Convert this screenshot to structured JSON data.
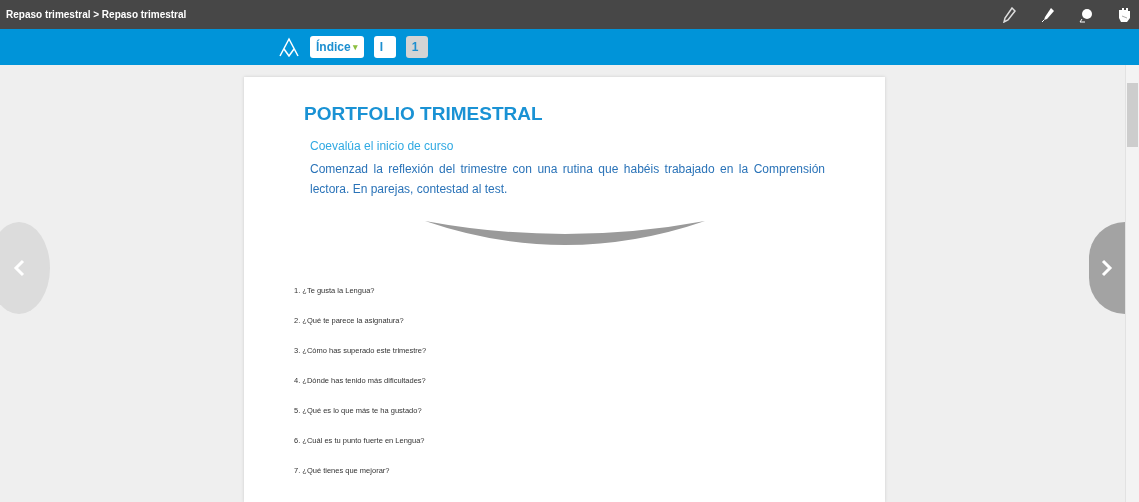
{
  "breadcrumb": "Repaso trimestral > Repaso trimestral",
  "tools": [
    {
      "kind": "pencil"
    },
    {
      "kind": "marker"
    },
    {
      "kind": "eraser"
    },
    {
      "kind": "hand"
    }
  ],
  "nav": {
    "index_label": "Índice",
    "index_caret": "▾",
    "pages": [
      {
        "label": "I",
        "selected": false
      },
      {
        "label": "1",
        "selected": true
      }
    ]
  },
  "document": {
    "title": "PORTFOLIO TRIMESTRAL",
    "subtitle": "Coevalúa el inicio de curso",
    "intro": "Comenzad la reflexión del trimestre con una rutina que habéis trabajado en la Comprensión lectora. En parejas, contestad al test.",
    "questions": [
      "1. ¿Te gusta la Lengua?",
      "2. ¿Qué te parece la asignatura?",
      "3. ¿Cómo has superado este trimestre?",
      "4. ¿Dónde has tenido más dificultades?",
      "5. ¿Qué es lo que más te ha gustado?",
      "6. ¿Cuál es tu punto fuerte en Lengua?",
      "7. ¿Qué tienes que mejorar?"
    ]
  },
  "pager": {
    "previous_disabled": true,
    "next_disabled": false
  }
}
